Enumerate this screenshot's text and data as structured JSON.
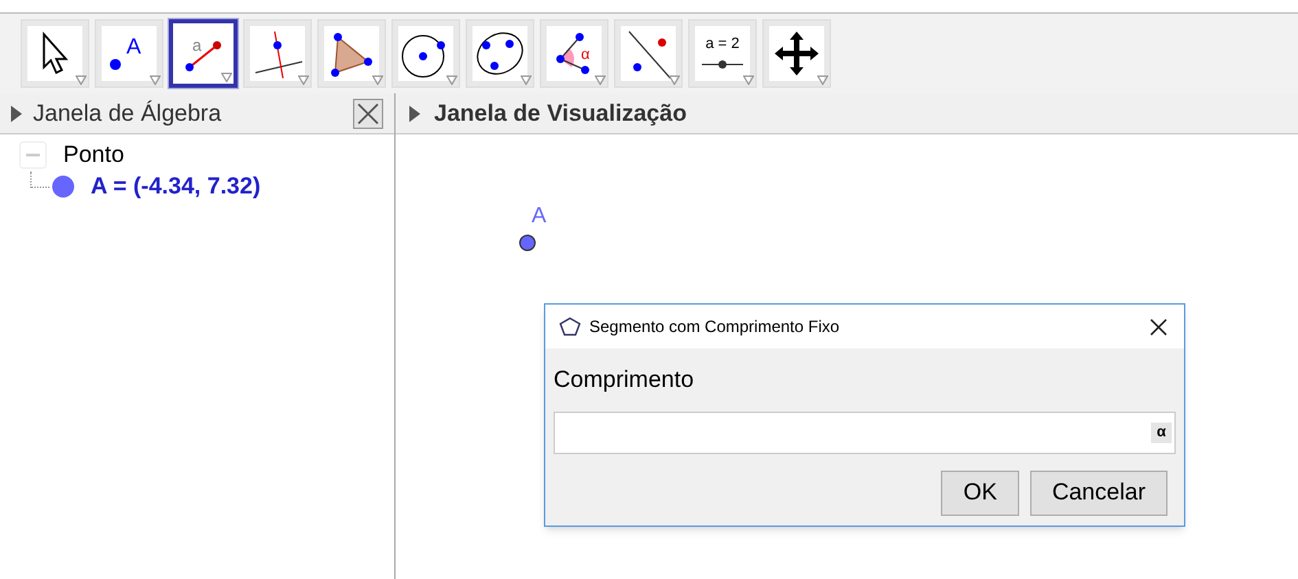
{
  "toolbar": [
    {
      "kind": "move",
      "selected": false
    },
    {
      "kind": "point",
      "label": "A",
      "selected": false
    },
    {
      "kind": "segment",
      "label": "a",
      "selected": true
    },
    {
      "kind": "perpendicular",
      "selected": false
    },
    {
      "kind": "polygon",
      "selected": false
    },
    {
      "kind": "circle",
      "selected": false
    },
    {
      "kind": "conic",
      "selected": false
    },
    {
      "kind": "angle",
      "label": "α",
      "selected": false
    },
    {
      "kind": "reflect",
      "selected": false
    },
    {
      "kind": "slider",
      "label": "a = 2",
      "selected": false
    },
    {
      "kind": "pan",
      "selected": false
    }
  ],
  "algebra": {
    "title": "Janela de Álgebra",
    "tree": [
      {
        "label": "Ponto",
        "expanded": true,
        "children": [
          {
            "label": "A = (-4.34, 7.32)",
            "color": "#6666ff"
          }
        ]
      }
    ]
  },
  "graphics": {
    "title": "Janela de Visualização",
    "points": [
      {
        "label": "A",
        "color": "#6666ff"
      }
    ]
  },
  "dialog": {
    "title": "Segmento com Comprimento Fixo",
    "field_label": "Comprimento",
    "symbol_button": "α",
    "buttons": [
      "OK",
      "Cancelar"
    ]
  }
}
